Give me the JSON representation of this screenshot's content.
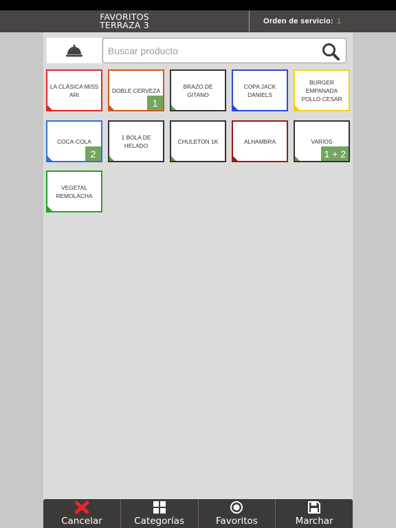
{
  "header": {
    "title_line1": "FAVORITOS",
    "title_line2": "TERRAZA 3",
    "order_label": "Orden de servicio:",
    "order_number": "1"
  },
  "search": {
    "placeholder": "Buscar producto",
    "value": ""
  },
  "icons": {
    "cloche": "cloche-icon",
    "search": "search-icon",
    "cancel": "x-icon",
    "categories": "grid-icon",
    "favorites": "circle-icon",
    "send": "floppy-disk-icon"
  },
  "products": [
    {
      "label": "LA CLÁSICA MISS ARI",
      "color": "#e0252b",
      "badge": ""
    },
    {
      "label": "DOBLE CERVEZA",
      "color": "#cc5a16",
      "badge": "1"
    },
    {
      "label": "BRAZO DE GITANO",
      "color": "#333333",
      "badge": ""
    },
    {
      "label": "COPA JACK DANIELS",
      "color": "#2b49d9",
      "badge": ""
    },
    {
      "label": "BURGER EMPANADA POLLO CESAR",
      "color": "#f0d11a",
      "badge": ""
    },
    {
      "label": "COCA-COLA",
      "color": "#2f6fd8",
      "badge": "2"
    },
    {
      "label": "1 BOLA DE HELADO",
      "color": "#333333",
      "badge": ""
    },
    {
      "label": "CHULETON 1K",
      "color": "#333333",
      "badge": ""
    },
    {
      "label": "ALHAMBRA",
      "color": "#9a1a16",
      "badge": ""
    },
    {
      "label": "VARIOS",
      "color": "#333333",
      "badge": "1 + 2"
    },
    {
      "label": "VEGETAL REMOLACHA",
      "color": "#21a31f",
      "badge": ""
    }
  ],
  "product_corner_colors": [
    "#e0252b",
    "#cc5a16",
    "#6aa23a",
    "#2b49d9",
    "#f0d11a",
    "#2f6fd8",
    "#6aa23a",
    "#6aa23a",
    "#9a1a16",
    "#6aa23a",
    "#21a31f"
  ],
  "bottombar": {
    "cancel_label": "Cancelar",
    "categories_label": "Categorías",
    "favorites_label": "Favoritos",
    "send_label": "Marchar",
    "cancel_color": "#e8242a"
  }
}
